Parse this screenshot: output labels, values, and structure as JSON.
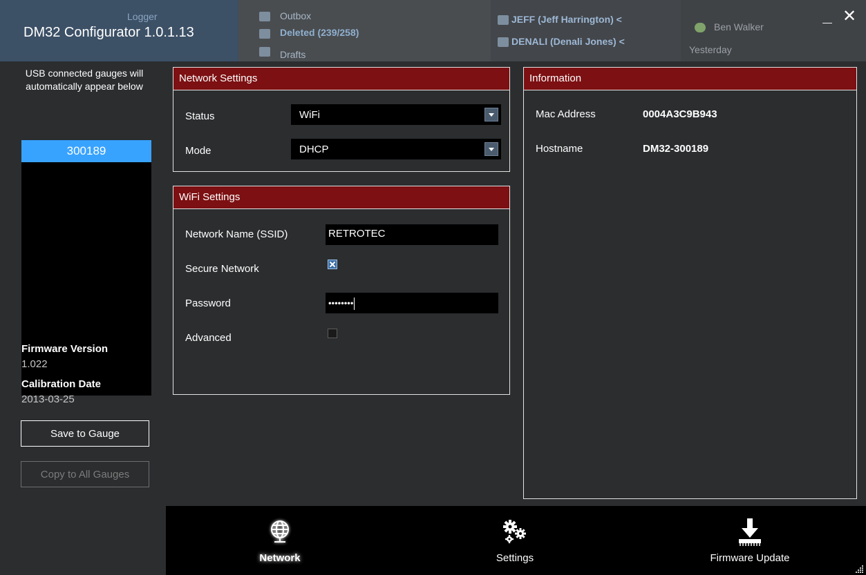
{
  "window": {
    "title": "DM32 Configurator 1.0.1.13",
    "minimize_glyph": "_",
    "close_glyph": "✕"
  },
  "background_app": {
    "left_text": "Logger",
    "folders": [
      "Outbox",
      "Deleted (239/258)",
      "Drafts"
    ],
    "messages": [
      "JEFF (Jeff Harrington) <",
      "DENALI (Denali Jones) <"
    ],
    "contacts": [
      "Ben Walker",
      "Yesterday"
    ]
  },
  "left_panel": {
    "usb_hint": "USB connected gauges will automatically appear below",
    "gauges": [
      "300189"
    ],
    "firmware_version_label": "Firmware Version",
    "firmware_version_value": "1.022",
    "calibration_date_label": "Calibration Date",
    "calibration_date_value": "2013-03-25",
    "save_button": "Save to Gauge",
    "copy_button": "Copy to All Gauges"
  },
  "network_settings": {
    "header": "Network Settings",
    "status_label": "Status",
    "status_value": "WiFi",
    "mode_label": "Mode",
    "mode_value": "DHCP"
  },
  "wifi_settings": {
    "header": "WiFi Settings",
    "ssid_label": "Network Name (SSID)",
    "ssid_value": "RETROTEC",
    "secure_label": "Secure Network",
    "secure_checked": true,
    "password_label": "Password",
    "password_value": "••••••••",
    "advanced_label": "Advanced",
    "advanced_checked": false
  },
  "information": {
    "header": "Information",
    "mac_label": "Mac Address",
    "mac_value": "0004A3C9B943",
    "hostname_label": "Hostname",
    "hostname_value": "DM32-300189"
  },
  "bottom_nav": {
    "items": [
      {
        "label": "Network",
        "icon": "globe-icon",
        "active": true
      },
      {
        "label": "Settings",
        "icon": "gears-icon",
        "active": false
      },
      {
        "label": "Firmware Update",
        "icon": "download-icon",
        "active": false
      }
    ]
  },
  "colors": {
    "accent_header": "#7c1012",
    "selection": "#38a3ff",
    "background": "#2b2d2f",
    "field_background": "#000000"
  }
}
